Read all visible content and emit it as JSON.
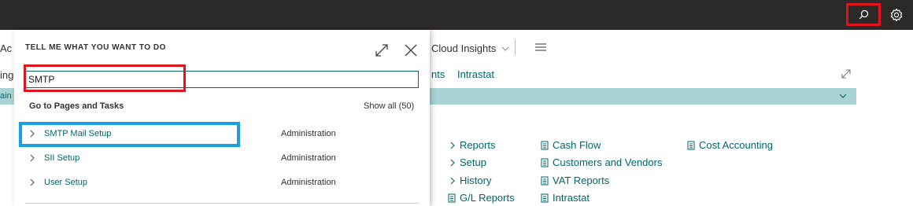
{
  "topbar": {
    "search_icon": "search-icon",
    "settings_icon": "gear-icon"
  },
  "background": {
    "partial_left_1": "Ac",
    "partial_left_2": "ing",
    "partial_left_3": "ain",
    "cloud_insights": "Cloud Insights",
    "nav_links": [
      "nts",
      "Intrastat"
    ],
    "col1": [
      "Reports",
      "Setup",
      "History",
      "G/L Reports"
    ],
    "col2": [
      "Cash Flow",
      "Customers and Vendors",
      "VAT Reports",
      "Intrastat"
    ],
    "col3": [
      "Cost Accounting"
    ]
  },
  "panel": {
    "title": "TELL ME WHAT YOU WANT TO DO",
    "search_value": "SMTP",
    "section_title": "Go to Pages and Tasks",
    "show_all": "Show all (50)",
    "results": [
      {
        "label": "SMTP Mail Setup",
        "category": "Administration"
      },
      {
        "label": "SII Setup",
        "category": "Administration"
      },
      {
        "label": "User Setup",
        "category": "Administration"
      }
    ]
  },
  "colors": {
    "accent": "#00666b",
    "highlight_red": "#e0141e",
    "highlight_blue": "#1a9fe0",
    "topbar": "#2b2a29"
  }
}
